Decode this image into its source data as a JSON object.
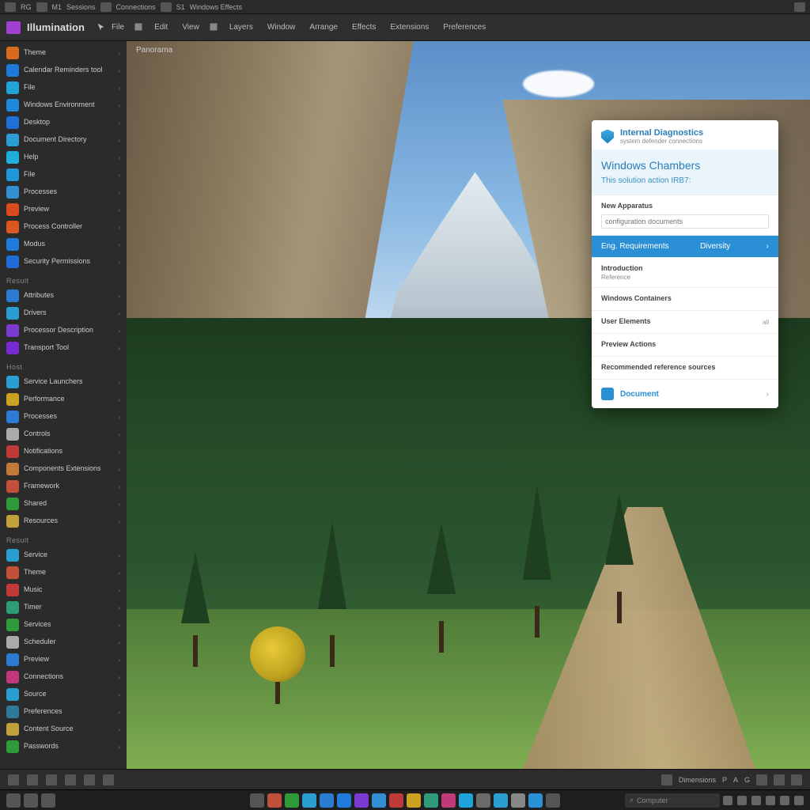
{
  "sysbar": {
    "items": [
      "RG",
      "M1",
      "Sessions",
      "Connections",
      "S1",
      "Windows Effects"
    ]
  },
  "app": {
    "name": "Illumination",
    "menu": [
      "File",
      "Edit",
      "View",
      "Layers",
      "Window",
      "Arrange",
      "Effects",
      "Extensions",
      "Preferences"
    ],
    "breadcrumb": "Panorama"
  },
  "sidebar": {
    "groups": [
      {
        "title": "",
        "items": [
          {
            "label": "Theme",
            "color": "#d96b1f"
          },
          {
            "label": "Calendar Reminders tool",
            "color": "#1f7ad9"
          },
          {
            "label": "File",
            "color": "#1fa3d9"
          },
          {
            "label": "Windows Environment",
            "color": "#1f89d9"
          },
          {
            "label": "Desktop",
            "color": "#1f6fd9"
          },
          {
            "label": "Document Directory",
            "color": "#2a9ed1"
          },
          {
            "label": "Help",
            "color": "#1fb0d9"
          },
          {
            "label": "File",
            "color": "#1f97d9"
          },
          {
            "label": "Processes",
            "color": "#328fd1"
          },
          {
            "label": "Preview",
            "color": "#d94b1f"
          },
          {
            "label": "Process Controller",
            "color": "#d9581f"
          },
          {
            "label": "Modus",
            "color": "#1f7ad9"
          },
          {
            "label": "Security Permissions",
            "color": "#1f6cd9"
          }
        ]
      },
      {
        "title": "Result",
        "items": [
          {
            "label": "Attributes",
            "color": "#2a7bd1"
          },
          {
            "label": "Drivers",
            "color": "#2a9ed1"
          },
          {
            "label": "Processor Description",
            "color": "#7a3ad1"
          },
          {
            "label": "Transport Tool",
            "color": "#7a2ad1"
          }
        ]
      },
      {
        "title": "Host",
        "items": [
          {
            "label": "Service Launchers",
            "color": "#2a9ed1"
          },
          {
            "label": "Performance",
            "color": "#caa21f"
          }
        ]
      },
      {
        "title": "",
        "items": [
          {
            "label": "Processes",
            "color": "#2a7bd1"
          },
          {
            "label": "Controls",
            "color": "#aaa"
          }
        ]
      },
      {
        "title": "",
        "items": [
          {
            "label": "Notifications",
            "color": "#c03a3a"
          },
          {
            "label": "Components Extensions",
            "color": "#c07a3a"
          },
          {
            "label": "Framework",
            "color": "#c0503a"
          },
          {
            "label": "Shared",
            "color": "#2f9a3a"
          },
          {
            "label": "Resources",
            "color": "#c0a03a"
          }
        ]
      },
      {
        "title": "Result",
        "items": [
          {
            "label": "Service",
            "color": "#2a9ed1"
          },
          {
            "label": "Theme",
            "color": "#c0503a"
          },
          {
            "label": "Music",
            "color": "#c03a3a"
          },
          {
            "label": "Timer",
            "color": "#2f9a7a"
          },
          {
            "label": "Services",
            "color": "#2f9a3a"
          },
          {
            "label": "Scheduler",
            "color": "#aaa"
          },
          {
            "label": "Preview",
            "color": "#2a7bd1"
          },
          {
            "label": "Connections",
            "color": "#c03a7a"
          },
          {
            "label": "Source",
            "color": "#2a9ed1"
          },
          {
            "label": "Preferences",
            "color": "#2f7a9a"
          },
          {
            "label": "Content Source",
            "color": "#c0a03a"
          },
          {
            "label": "Passwords",
            "color": "#2f9a3a"
          }
        ]
      }
    ]
  },
  "popup": {
    "brand": "Internal Diagnostics",
    "brand_sub": "system defender connections",
    "title": "Windows Chambers",
    "subtitle": "This solution action IRB7:",
    "section_label": "New Apparatus",
    "input_placeholder": "configuration documents",
    "highlight_left": "Eng. Requirements",
    "highlight_right": "Diversity",
    "rows": [
      {
        "t": "Introduction",
        "d": "Reference"
      },
      {
        "t": "Windows Containers",
        "d": ""
      },
      {
        "t": "User Elements",
        "d": "",
        "r": "all"
      },
      {
        "t": "Preview Actions",
        "d": "",
        "r": ""
      },
      {
        "t": "Recommended reference sources",
        "d": ""
      }
    ],
    "footer": "Document",
    "footer_arrow": "›"
  },
  "statusbar": {
    "left_icons": 6,
    "right_label": "Dimensions",
    "right_icons": [
      "P",
      "A",
      "G",
      "layers",
      "grid",
      "more"
    ]
  },
  "taskbar": {
    "search_placeholder": "Computer",
    "icons": 18,
    "tray_icons": 6
  },
  "colors": {
    "accent": "#2b8fd6",
    "panel": "#2b2b2b"
  }
}
